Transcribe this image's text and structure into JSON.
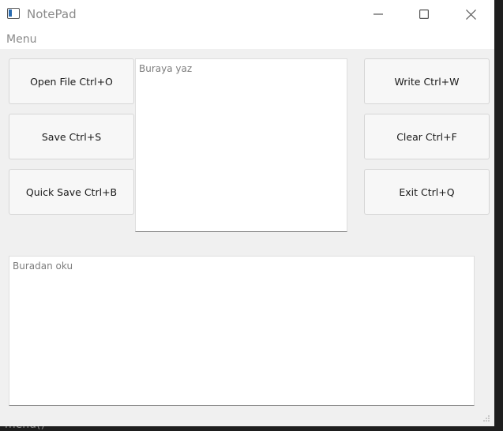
{
  "background_text": "menu()",
  "window": {
    "title": "NotePad",
    "menu": {
      "label": "Menu"
    }
  },
  "buttons": {
    "open_file": "Open File Ctrl+O",
    "save": "Save Ctrl+S",
    "quick_save": "Quick Save Ctrl+B",
    "write": "Write Ctrl+W",
    "clear": "Clear Ctrl+F",
    "exit": "Exit Ctrl+Q"
  },
  "editor": {
    "placeholder": "Buraya yaz",
    "value": ""
  },
  "reader": {
    "placeholder": "Buradan oku",
    "value": ""
  },
  "colors": {
    "window_bg": "#f0f0f0",
    "titlebar_bg": "#ffffff",
    "desktop_bg": "#1e1e1e"
  }
}
